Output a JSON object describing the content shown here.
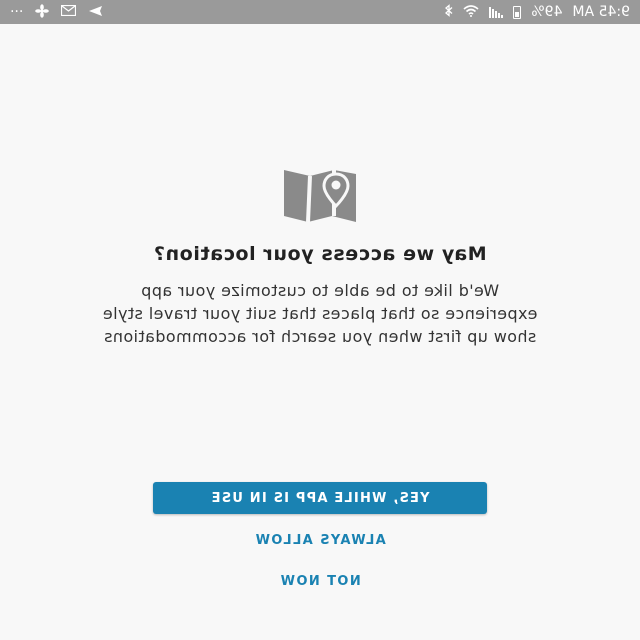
{
  "status_bar": {
    "time": "9:45 AM",
    "battery_percent": "49%",
    "battery_level": 0.49,
    "overflow": "···",
    "icons": [
      "battery-icon",
      "signal-icon",
      "wifi-icon",
      "bluetooth-icon",
      "fan-icon",
      "gmail-icon",
      "send-icon"
    ]
  },
  "dialog": {
    "icon": "map-pin-icon",
    "title": "May we access your location?",
    "body_lines": [
      "We'd like to be able to customize your app",
      "experience so that places that suit your travel style",
      "show up first when you search for accommodations"
    ]
  },
  "actions": {
    "primary": "YES, WHILE APP IS IN USE",
    "secondary": "ALWAYS ALLOW",
    "tertiary": "NOT NOW"
  },
  "colors": {
    "accent": "#1a82b2",
    "status_bar": "#9a9a9a",
    "background": "#f8f8f8",
    "icon": "#8a8a8a"
  }
}
